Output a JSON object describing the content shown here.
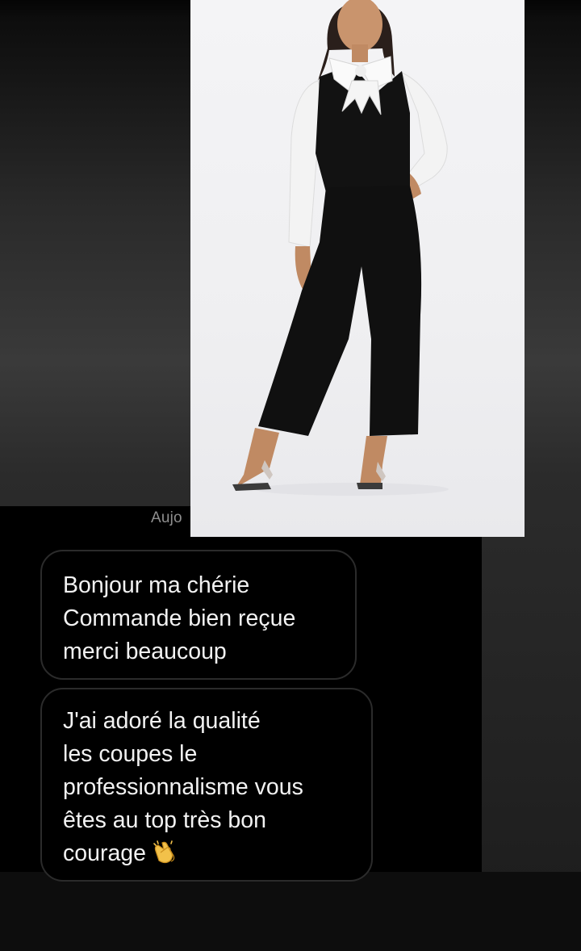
{
  "conversation": {
    "date_label": "Aujo",
    "messages": [
      {
        "lines": [
          "Bonjour ma chérie",
          "Commande bien reçue",
          "merci beaucoup"
        ]
      },
      {
        "lines": [
          "J'ai adoré la qualité",
          "les coupes le",
          "professionnalisme vous",
          "êtes au top très bon",
          "courage"
        ],
        "emoji": "clapping-hands-icon"
      }
    ]
  },
  "colors": {
    "chat_background": "#000000",
    "bubble_border": "#2b2b2b",
    "message_text": "#f2f2f2",
    "date_text": "#8e8e8e",
    "photo_background": "#f2f2f4"
  }
}
